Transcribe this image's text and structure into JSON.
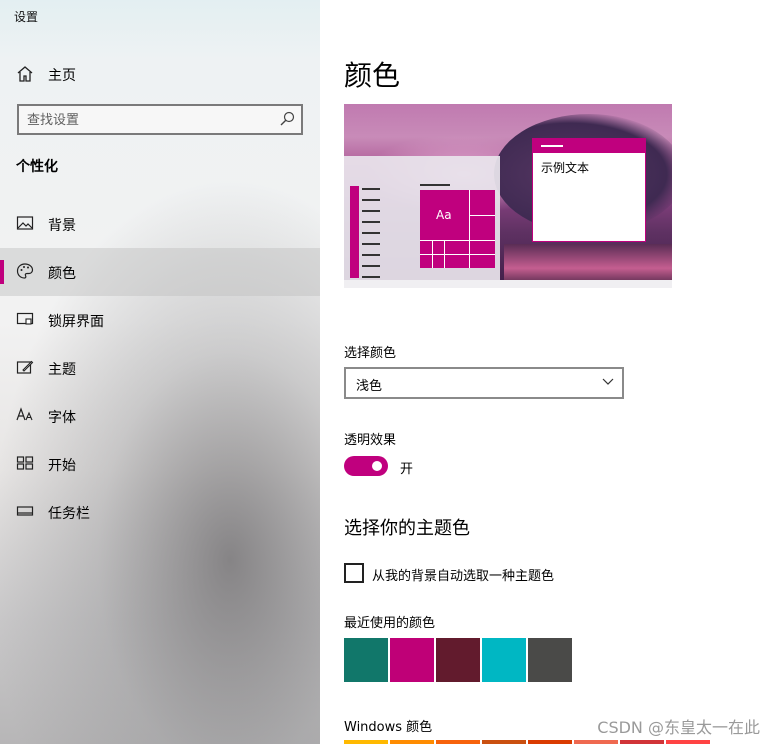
{
  "accent": "#c0007e",
  "window": {
    "title": "设置"
  },
  "sidebar": {
    "home_label": "主页",
    "search_placeholder": "查找设置",
    "section_title": "个性化",
    "items": [
      {
        "label": "背景",
        "icon": "picture-icon"
      },
      {
        "label": "颜色",
        "icon": "palette-icon",
        "active": true
      },
      {
        "label": "锁屏界面",
        "icon": "lockscreen-icon"
      },
      {
        "label": "主题",
        "icon": "theme-icon"
      },
      {
        "label": "字体",
        "icon": "font-icon"
      },
      {
        "label": "开始",
        "icon": "start-icon"
      },
      {
        "label": "任务栏",
        "icon": "taskbar-icon"
      }
    ]
  },
  "main": {
    "title": "颜色",
    "preview": {
      "tile_text": "Aa",
      "sample_text": "示例文本"
    },
    "choose_color": {
      "label": "选择颜色",
      "value": "浅色"
    },
    "transparency": {
      "label": "透明效果",
      "state": "开",
      "on": true
    },
    "accent_title": "选择你的主题色",
    "auto_accent_label": "从我的背景自动选取一种主题色",
    "recent_label": "最近使用的颜色",
    "recent_colors": [
      "#11776a",
      "#bf0077",
      "#621b2d",
      "#00b7c3",
      "#4a4a48"
    ],
    "windows_colors_label": "Windows 颜色",
    "windows_colors": [
      "#ffb900",
      "#ff8c00",
      "#f7630c",
      "#ca5010",
      "#da3b01",
      "#ef6950",
      "#d13438",
      "#ff4343"
    ]
  },
  "watermark": "CSDN @东皇太一在此"
}
